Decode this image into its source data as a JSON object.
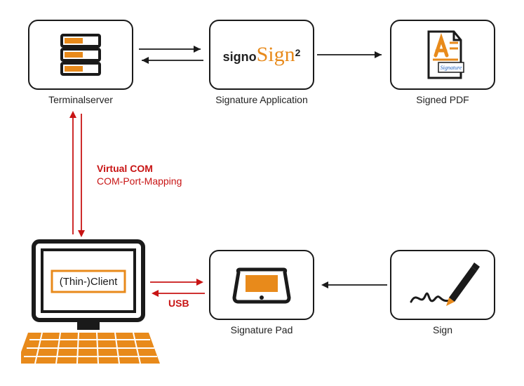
{
  "nodes": {
    "terminal_server": {
      "label": "Terminalserver"
    },
    "signature_app": {
      "label": "Signature Application",
      "logo_prefix": "signo",
      "logo_script": "Sign",
      "logo_sup": "2"
    },
    "signed_pdf": {
      "label": "Signed PDF",
      "stamp": "Signature"
    },
    "thin_client": {
      "inner_label": "(Thin-)Client"
    },
    "signature_pad": {
      "label": "Signature Pad"
    },
    "sign": {
      "label": "Sign"
    }
  },
  "connections": {
    "virtual_com": {
      "line1": "Virtual COM",
      "line2": "COM-Port-Mapping"
    },
    "usb": {
      "label": "USB"
    }
  },
  "diagram_description": "Architecture diagram: a Terminalserver communicates bidirectionally with a Signature Application (signoSign²), which outputs a Signed PDF. The Terminalserver connects over Virtual COM / COM-Port-Mapping down to a (Thin-)Client workstation. The Thin-Client connects over USB bidirectionally to a Signature Pad, which receives input from a handwritten Sign action."
}
